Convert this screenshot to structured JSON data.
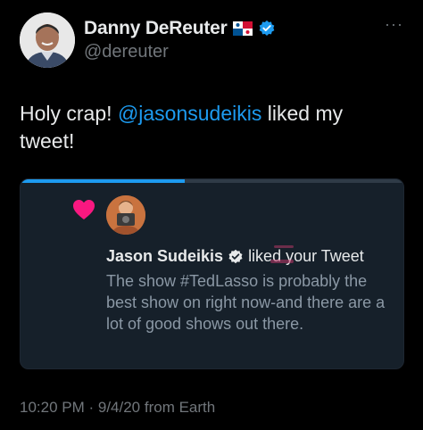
{
  "author": {
    "display_name": "Danny DeReuter",
    "handle": "@dereuter",
    "flag_emoji": "panama-flag",
    "verified_icon": "verified-badge-icon"
  },
  "menu": {
    "more_label": "···"
  },
  "tweet": {
    "text_before": "Holy crap! ",
    "mention": "@jasonsudeikis",
    "text_after": " liked my tweet!"
  },
  "card": {
    "progress_fraction": 0.43,
    "heart_icon": "heart-icon",
    "notification": {
      "name": "Jason Sudeikis",
      "action": "liked your Tweet"
    },
    "quoted_tweet": "The show #TedLasso is probably the best show on right now-and there are a lot of good shows out there."
  },
  "footer": {
    "time": "10:20 PM",
    "separator": " · ",
    "date": "9/4/20",
    "source": " from Earth"
  },
  "colors": {
    "background": "#000000",
    "accent": "#1d9bf0",
    "heart": "#f91880",
    "muted": "#71767b",
    "card_bg": "#16202a"
  }
}
